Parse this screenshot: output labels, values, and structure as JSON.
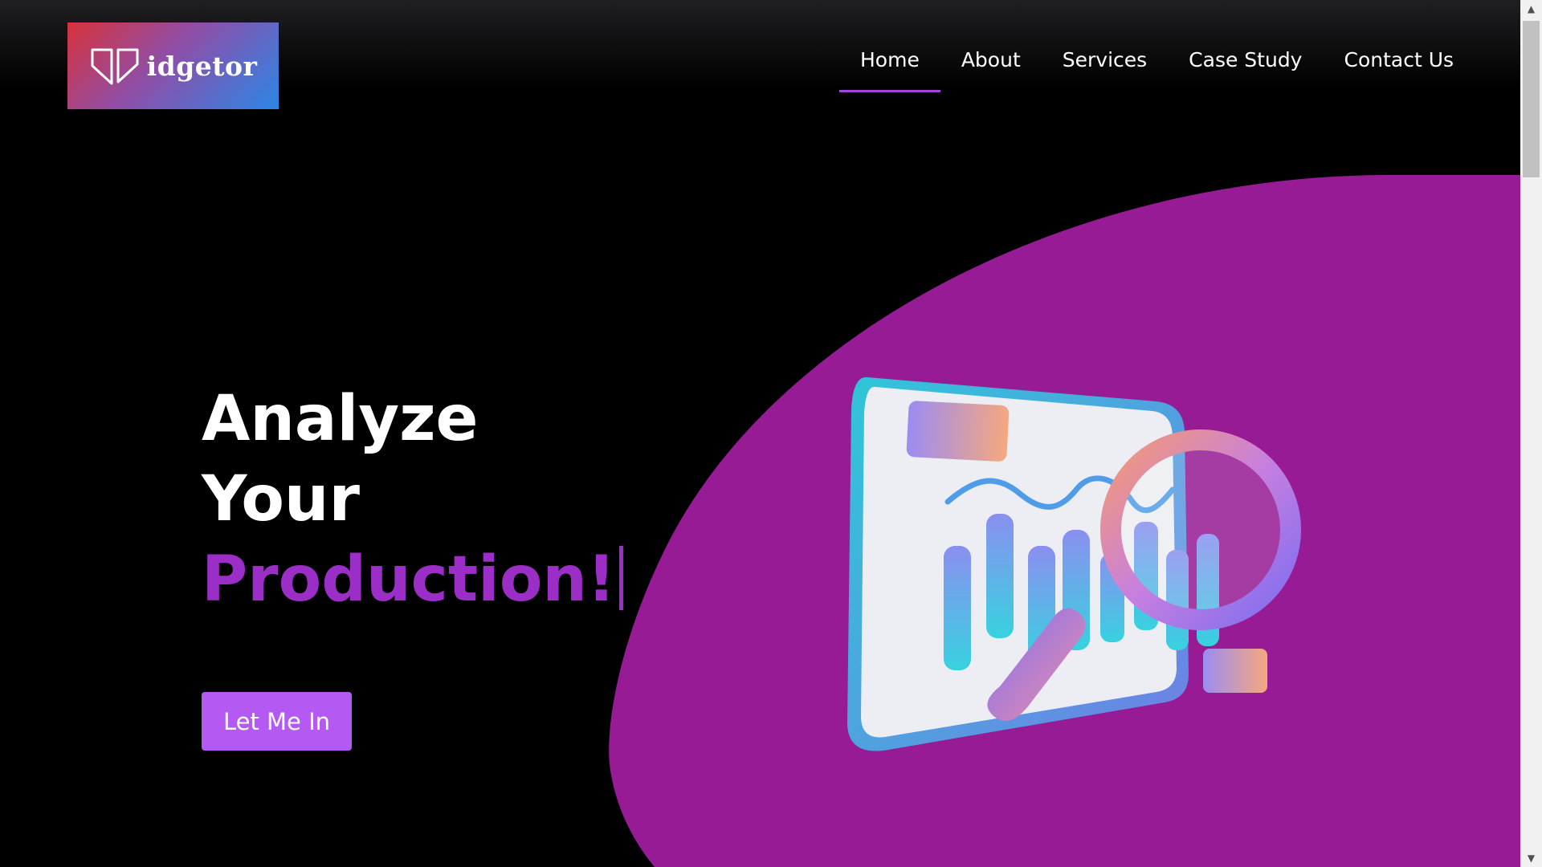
{
  "logo": {
    "text": "idgetor",
    "gradient": [
      "#d8323a",
      "#8f4ea8",
      "#2b86e6"
    ]
  },
  "nav": {
    "items": [
      {
        "label": "Home",
        "active": true
      },
      {
        "label": "About",
        "active": false
      },
      {
        "label": "Services",
        "active": false
      },
      {
        "label": "Case Study",
        "active": false
      },
      {
        "label": "Contact Us",
        "active": false
      }
    ],
    "active_color": "#a445e0"
  },
  "hero": {
    "line1": "Analyze",
    "line2": "Your",
    "line3": "Production!",
    "cta_label": "Let Me In"
  },
  "colors": {
    "background": "#000000",
    "blob": "#961b95",
    "accent_text": "#9b2ec7",
    "button": "#b45af2"
  },
  "illustration": {
    "icon": "analytics-magnifier-icon"
  }
}
